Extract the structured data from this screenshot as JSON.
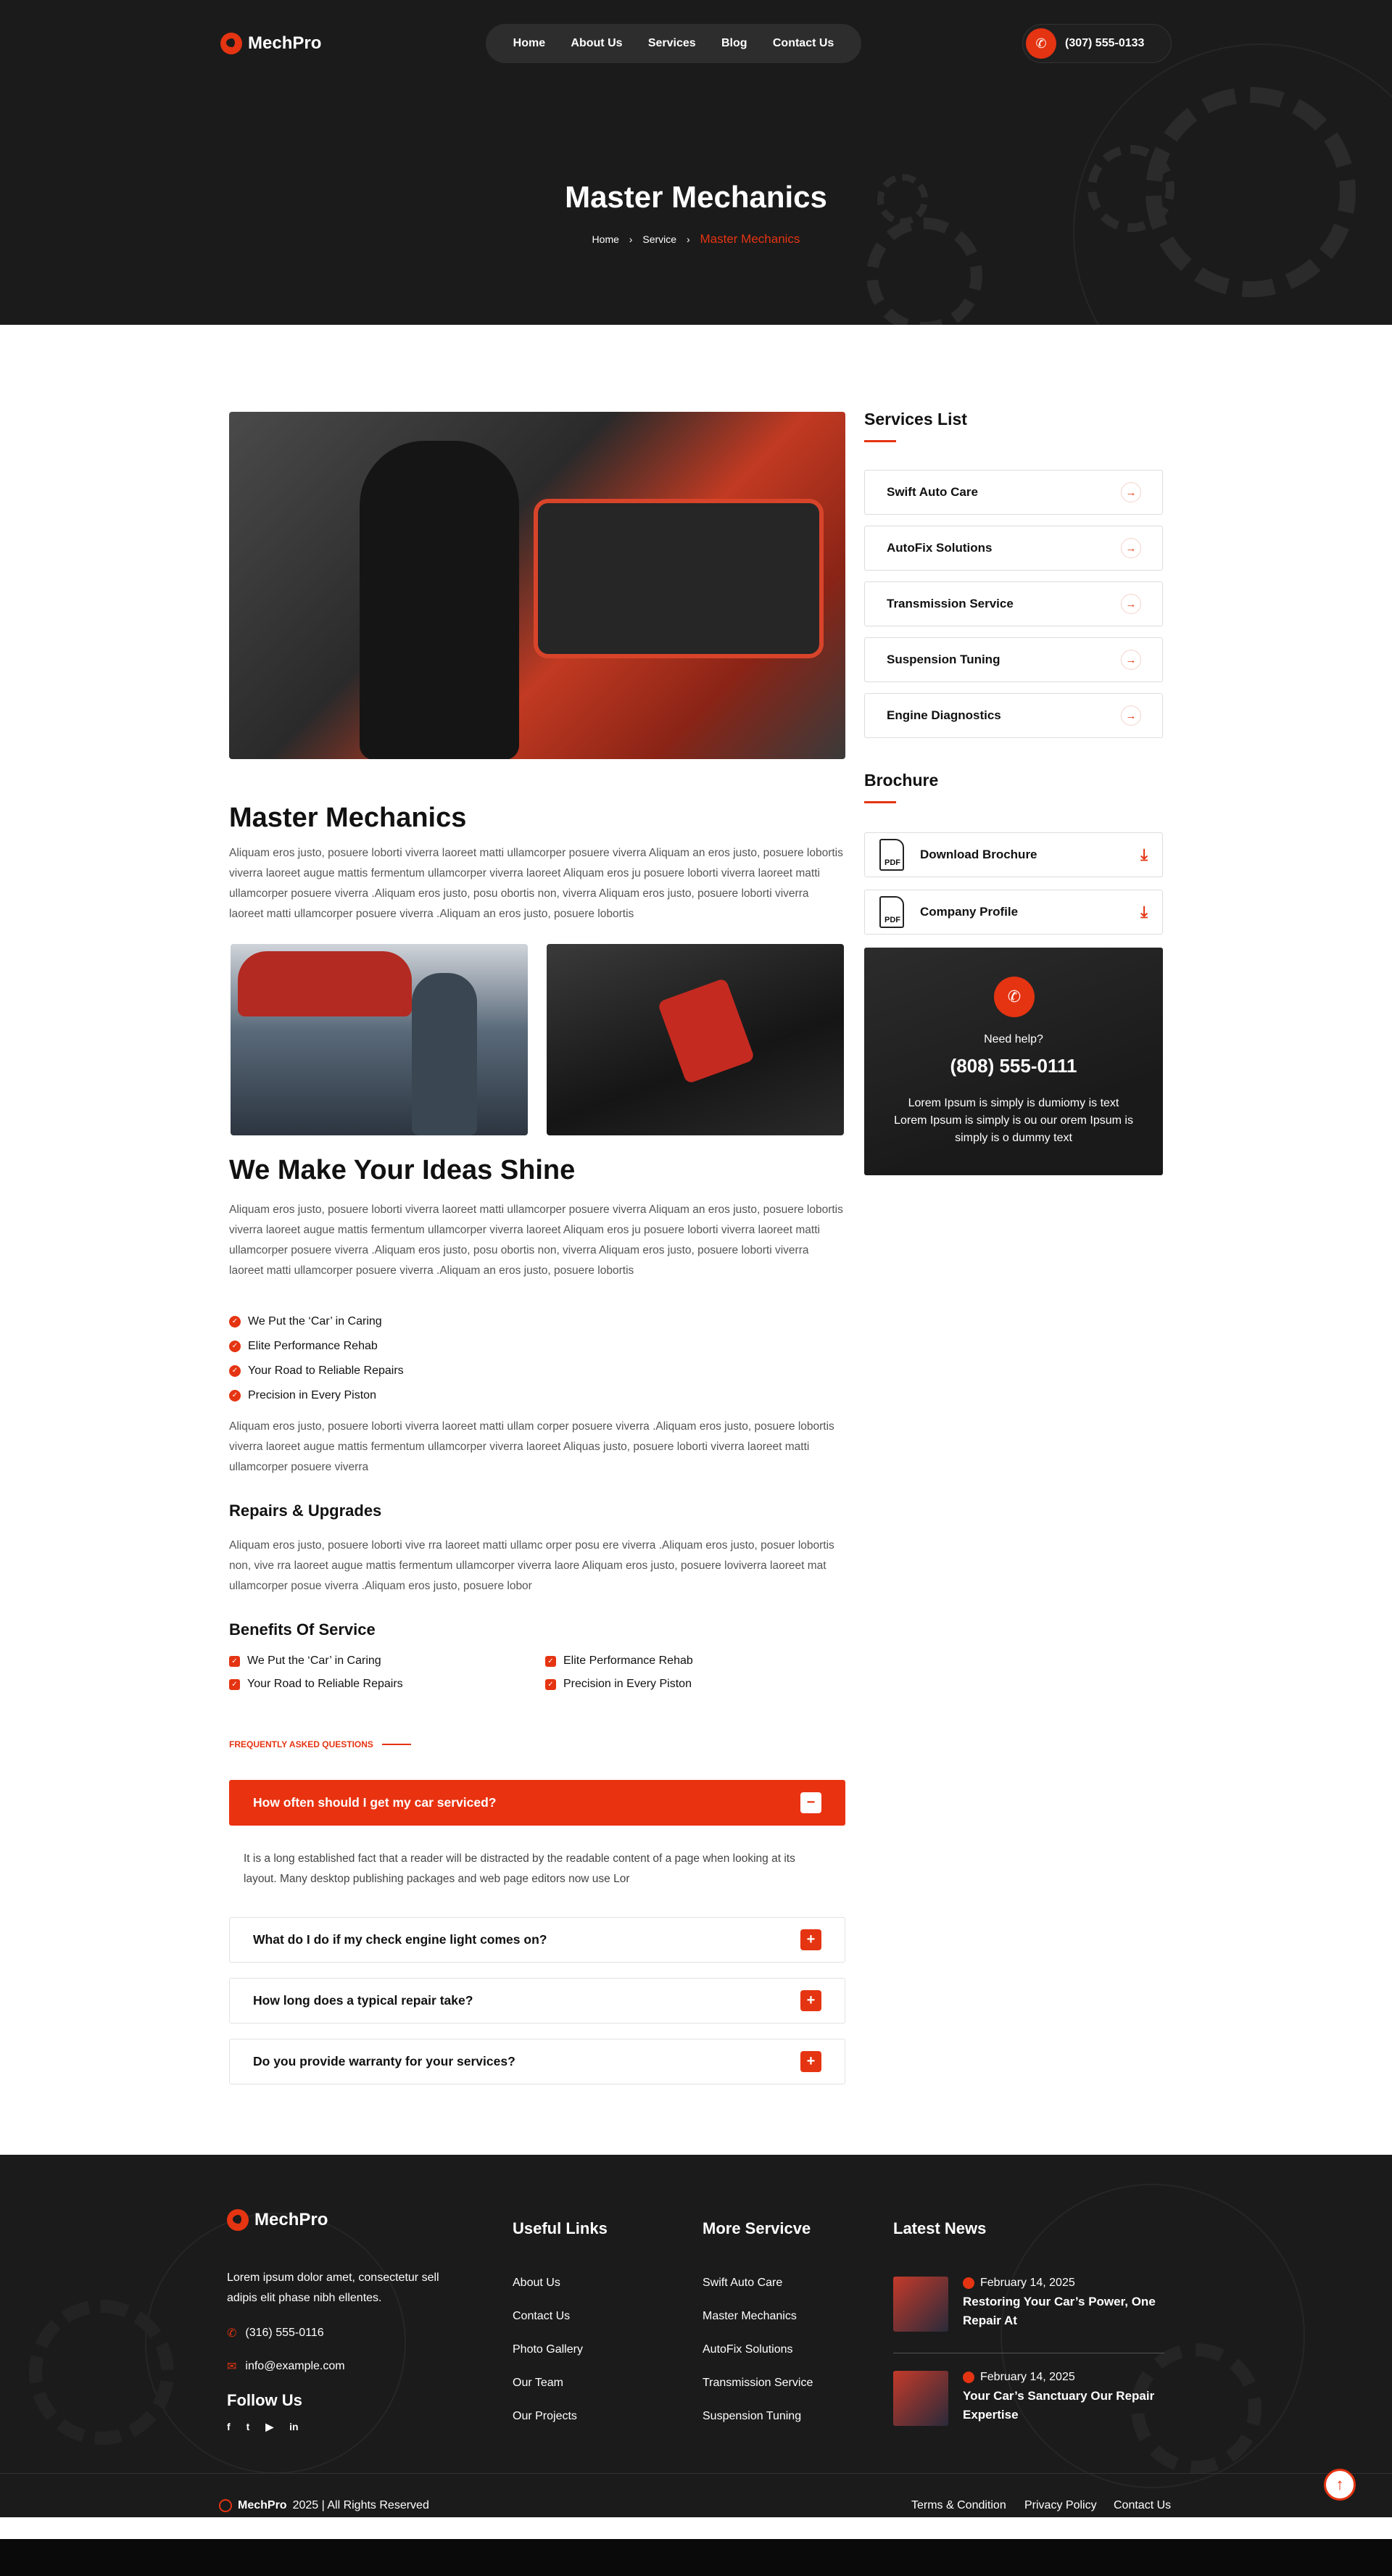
{
  "brand": {
    "name": "MechPro"
  },
  "nav": {
    "items": [
      "Home",
      "About Us",
      "Services",
      "Blog",
      "Contact Us"
    ],
    "phone": "(307) 555-0133"
  },
  "hero": {
    "title": "Master Mechanics",
    "breadcrumb": [
      "Home",
      "Service",
      "Master Mechanics"
    ]
  },
  "main": {
    "title": "Master Mechanics",
    "intro": "Aliquam eros justo, posuere loborti viverra laoreet matti ullamcorper posuere viverra Aliquam an eros justo, posuere lobortis viverra laoreet augue mattis fermentum ullamcorper viverra laoreet Aliquam eros ju posuere loborti viverra laoreet matti ullamcorper posuere viverra .Aliquam eros justo, posu obortis non, viverra Aliquam eros justo, posuere loborti viverra laoreet matti ullamcorper posuere viverra .Aliquam an eros justo, posuere lobortis",
    "title2": "We Make Your Ideas Shine",
    "para2": "Aliquam eros justo, posuere loborti viverra laoreet matti ullamcorper posuere viverra Aliquam an eros justo, posuere lobortis viverra laoreet augue mattis fermentum ullamcorper viverra laoreet Aliquam eros ju posuere loborti viverra laoreet matti ullamcorper posuere viverra .Aliquam eros justo, posu obortis non, viverra Aliquam eros justo, posuere loborti viverra laoreet matti ullamcorper posuere viverra .Aliquam an eros justo, posuere lobortis",
    "checklist": [
      "We Put the ‘Car’ in Caring",
      "Elite Performance Rehab",
      "Your Road to Reliable Repairs",
      "Precision in Every Piston"
    ],
    "para3": "Aliquam eros justo, posuere loborti viverra laoreet matti ullam corper posuere viverra .Aliquam eros justo, posuere lobortis viverra laoreet augue mattis fermentum ullamcorper viverra laoreet Aliquas justo, posuere loborti viverra laoreet matti ullamcorper posuere viverra",
    "repairs_title": "Repairs & Upgrades",
    "repairs_text": "Aliquam eros justo, posuere loborti vive rra laoreet matti ullamc orper posu ere viverra .Aliquam eros justo, posuer lobortis non, vive rra laoreet augue mattis fermentum ullamcorper viverra laore Aliquam eros justo, posuere loviverra laoreet mat ullamcorper posue viverra .Aliquam eros justo, posuere lobor",
    "benefits_title": "Benefits Of Service",
    "benefits": [
      "We Put the ‘Car’ in Caring",
      "Elite Performance Rehab",
      "Your Road to Reliable Repairs",
      "Precision in Every Piston"
    ]
  },
  "faq": {
    "tag": "FREQUENTLY ASKED QUESTIONS",
    "items": [
      {
        "q": "How often should I get my car serviced?",
        "icon": "−",
        "a": "It is a long established fact that a reader will be distracted by the readable content of a page when looking at its layout. Many desktop publishing packages and web page editors now use Lor"
      },
      {
        "q": "What do I do if my check engine light comes on?",
        "icon": "+"
      },
      {
        "q": "How long does a typical repair take?",
        "icon": "+"
      },
      {
        "q": "Do you provide warranty for your services?",
        "icon": "+"
      }
    ]
  },
  "sidebar": {
    "services_title": "Services List",
    "services": [
      "Swift Auto Care",
      "AutoFix Solutions",
      "Transmission Service",
      "Suspension Tuning",
      "Engine Diagnostics"
    ],
    "brochure_title": "Brochure",
    "brochures": [
      "Download Brochure",
      "Company Profile"
    ],
    "pdf_label": "PDF",
    "help": {
      "label": "Need help?",
      "phone": "(808) 555-0111",
      "text": "Lorem Ipsum is simply is dumiomy is text Lorem Ipsum is simply is ou our orem Ipsum is simply is o dummy text"
    }
  },
  "footer": {
    "brand": "MechPro",
    "about": "Lorem ipsum dolor amet, consectetur sell adipis elit phase nibh ellentes.",
    "phone": "(316) 555-0116",
    "email": "info@example.com",
    "follow_title": "Follow Us",
    "social": [
      "f",
      "t",
      "▶",
      "in"
    ],
    "useful_title": "Useful Links",
    "useful": [
      "About Us",
      "Contact Us",
      "Photo Gallery",
      "Our Team",
      "Our Projects"
    ],
    "more_title": "More Servicve",
    "more": [
      "Swift Auto Care",
      "Master Mechanics",
      "AutoFix Solutions",
      "Transmission Service",
      "Suspension Tuning"
    ],
    "news_title": "Latest News",
    "news": [
      {
        "date": "February 14, 2025",
        "title": "Restoring Your Car’s Power, One Repair At"
      },
      {
        "date": "February 14, 2025",
        "title": "Your Car’s Sanctuary Our Repair Expertise"
      }
    ],
    "copy_brand": "MechPro",
    "copy_text": "2025 | All Rights Reserved",
    "legal": [
      "Terms & Condition",
      "Privacy Policy",
      "Contact Us"
    ]
  },
  "colors": {
    "accent": "#e53412",
    "dark": "#1b1b1b"
  }
}
